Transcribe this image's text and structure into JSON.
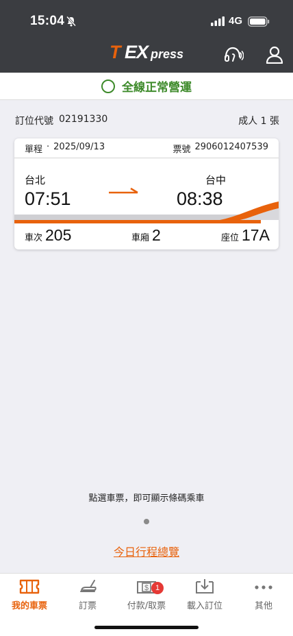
{
  "status_bar": {
    "time": "15:04",
    "network": "4G"
  },
  "header": {
    "logo_t": "T",
    "logo_ex": "EX",
    "logo_press": "press"
  },
  "service": {
    "status_text": "全線正常營運",
    "color": "#3d8a2a"
  },
  "booking": {
    "code_label": "訂位代號",
    "code": "02191330",
    "passengers": "成人 1 張"
  },
  "ticket": {
    "trip_type": "單程",
    "separator": "·",
    "date": "2025/09/13",
    "ticket_no_label": "票號",
    "ticket_no": "2906012407539",
    "from_station": "台北",
    "to_station": "台中",
    "depart_time": "07:51",
    "arrive_time": "08:38",
    "train_label": "車次",
    "train_no": "205",
    "car_label": "車廂",
    "car_no": "2",
    "seat_label": "座位",
    "seat_no": "17A"
  },
  "hint": "點選車票，即可顯示條碼乘車",
  "overview_link": "今日行程總覽",
  "tabs": [
    {
      "label": "我的車票",
      "icon": "ticket-icon",
      "active": true
    },
    {
      "label": "訂票",
      "icon": "seat-icon",
      "active": false
    },
    {
      "label": "付款/取票",
      "icon": "payment-icon",
      "active": false,
      "badge": "1"
    },
    {
      "label": "載入訂位",
      "icon": "download-icon",
      "active": false
    },
    {
      "label": "其他",
      "icon": "more-icon",
      "active": false
    }
  ],
  "colors": {
    "accent": "#e8620c",
    "header_bg": "#3b3d41",
    "badge": "#e53935"
  }
}
